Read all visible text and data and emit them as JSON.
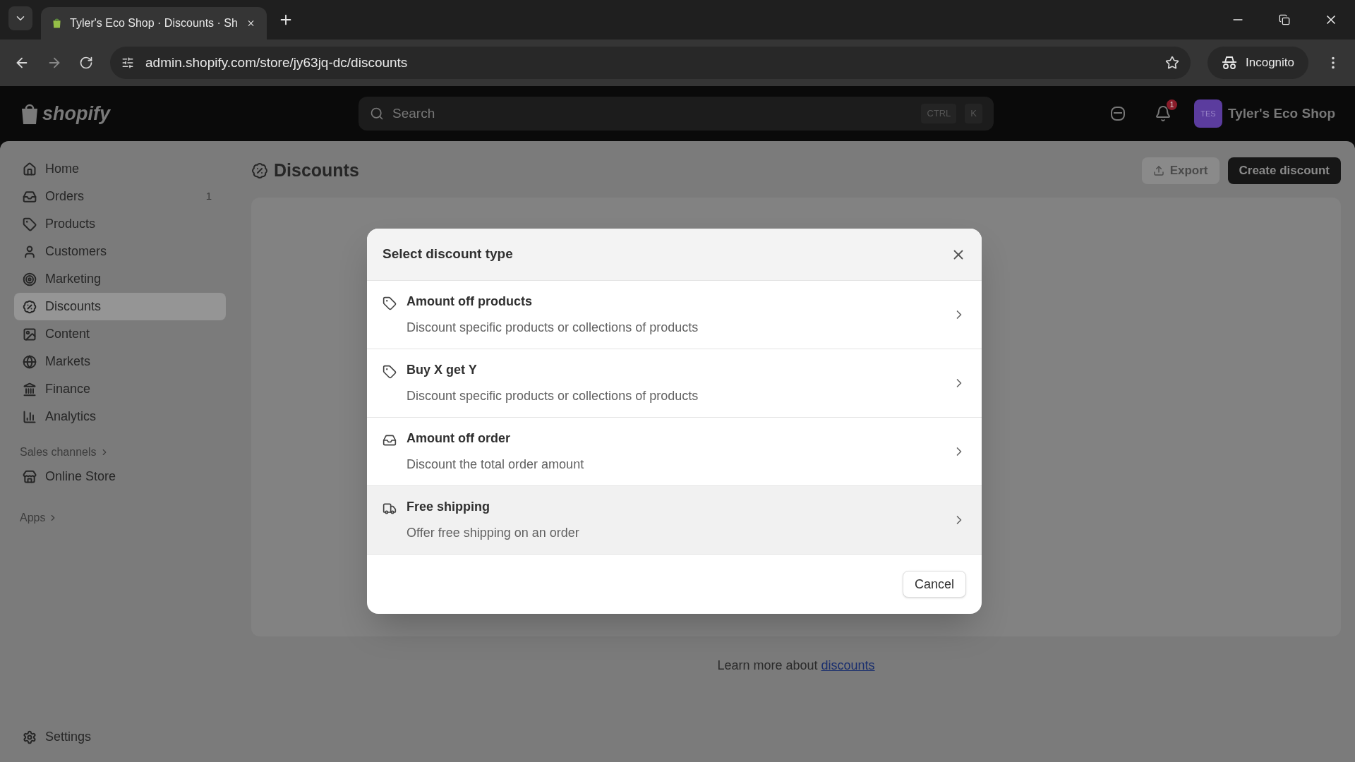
{
  "browser": {
    "tab_title": "Tyler's Eco Shop · Discounts · Sh",
    "url": "admin.shopify.com/store/jy63jq-dc/discounts",
    "profile": "Incognito"
  },
  "topbar": {
    "logo": "shopify",
    "search": {
      "placeholder": "Search",
      "keys": [
        "CTRL",
        "K"
      ]
    },
    "notification_count": "1",
    "avatar": "TES",
    "store": "Tyler's Eco Shop"
  },
  "sidebar": {
    "items": [
      {
        "label": "Home",
        "selected": false
      },
      {
        "label": "Orders",
        "selected": false,
        "count": "1"
      },
      {
        "label": "Products",
        "selected": false
      },
      {
        "label": "Customers",
        "selected": false
      },
      {
        "label": "Marketing",
        "selected": false
      },
      {
        "label": "Discounts",
        "selected": true
      },
      {
        "label": "Content",
        "selected": false
      },
      {
        "label": "Markets",
        "selected": false
      },
      {
        "label": "Finance",
        "selected": false
      },
      {
        "label": "Analytics",
        "selected": false
      }
    ],
    "sales_channels": {
      "heading": "Sales channels",
      "items": [
        {
          "label": "Online Store",
          "selected": false
        }
      ]
    },
    "apps": {
      "heading": "Apps"
    },
    "settings": "Settings"
  },
  "page": {
    "title": "Discounts",
    "actions": [
      "Export",
      "Create discount"
    ],
    "learn_more": "Learn more about ",
    "learn_more_link": "discounts"
  },
  "dialog": {
    "title": "Select discount type",
    "options": [
      {
        "title": "Amount off products",
        "description": "Discount specific products or collections of products",
        "highlighted": false
      },
      {
        "title": "Buy X get Y",
        "description": "Discount specific products or collections of products",
        "highlighted": false
      },
      {
        "title": "Amount off order",
        "description": "Discount the total order amount",
        "highlighted": false
      },
      {
        "title": "Free shipping",
        "description": "Offer free shipping on an order",
        "highlighted": true
      }
    ],
    "cancel": "Cancel"
  }
}
